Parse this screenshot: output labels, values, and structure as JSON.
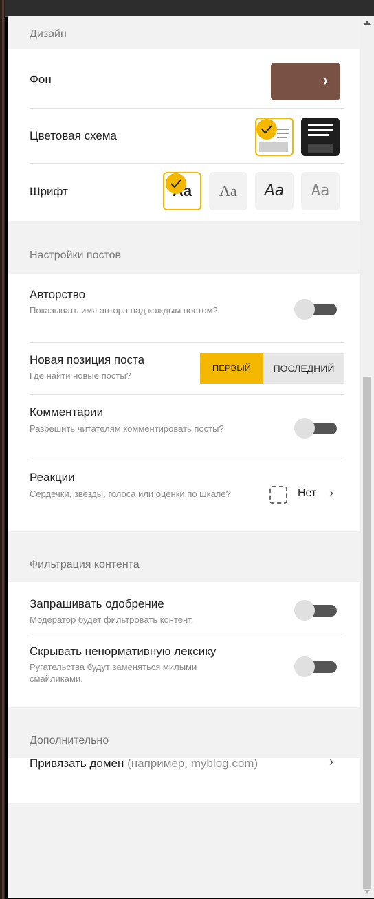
{
  "design": {
    "header": "Дизайн",
    "background": {
      "label": "Фон",
      "color": "#7a5245",
      "button_icon": "chevron-right-icon"
    },
    "color_scheme": {
      "label": "Цветовая схема",
      "options": [
        "light",
        "dark"
      ],
      "selected": "light"
    },
    "font": {
      "label": "Шрифт",
      "options": [
        "Aa",
        "Aa",
        "Aa",
        "Aa"
      ],
      "selected": 0
    }
  },
  "posts": {
    "header": "Настройки постов",
    "authorship": {
      "label": "Авторство",
      "description": "Показывать имя автора над каждым постом?",
      "enabled": false
    },
    "new_position": {
      "label": "Новая позиция поста",
      "description": "Где найти новые посты?",
      "first": "ПЕРВЫЙ",
      "last": "ПОСЛЕДНИЙ",
      "selected": "first"
    },
    "comments": {
      "label": "Комментарии",
      "description": "Разрешить читателям комментировать посты?",
      "enabled": false
    },
    "reactions": {
      "label": "Реакции",
      "description": "Сердечки, звезды, голоса или оценки по шкале?",
      "value": "Нет"
    }
  },
  "filtering": {
    "header": "Фильтрация контента",
    "approval": {
      "label": "Запрашивать одобрение",
      "description": "Модератор будет фильтровать контент.",
      "enabled": false
    },
    "profanity": {
      "label": "Скрывать ненормативную лексику",
      "description": "Ругательства будут заменяться милыми смайликами.",
      "enabled": false
    }
  },
  "extra": {
    "header": "Дополнительно",
    "domain": {
      "label": "Привязать домен",
      "hint": "(например, myblog.com)"
    }
  },
  "colors": {
    "accent": "#f5b800",
    "toggle_track": "#555555"
  }
}
